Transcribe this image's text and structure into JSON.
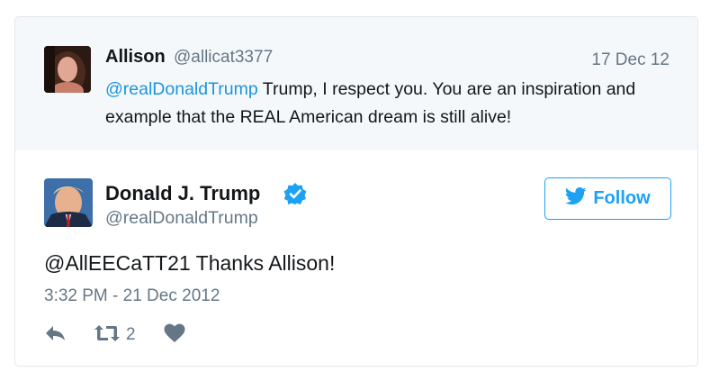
{
  "parent_tweet": {
    "author_name": "Allison",
    "author_handle": "@allicat3377",
    "date": "17 Dec 12",
    "mention": "@realDonaldTrump",
    "text": " Trump, I respect you. You are an inspiration and example that the REAL American dream is still alive!"
  },
  "main_tweet": {
    "author_name": "Donald J. Trump",
    "author_handle": "@realDonaldTrump",
    "verified_icon": "verified-badge-icon",
    "follow_label": "Follow",
    "text": "@AllEECaTT21 Thanks Allison!",
    "timestamp": "3:32 PM - 21 Dec 2012",
    "actions": {
      "reply_icon": "reply-icon",
      "retweet_icon": "retweet-icon",
      "retweet_count": "2",
      "like_icon": "heart-icon"
    }
  },
  "colors": {
    "link": "#1b95e0",
    "follow_accent": "#1da1f2",
    "muted": "#657786",
    "parent_bg": "#f5f8fa"
  }
}
